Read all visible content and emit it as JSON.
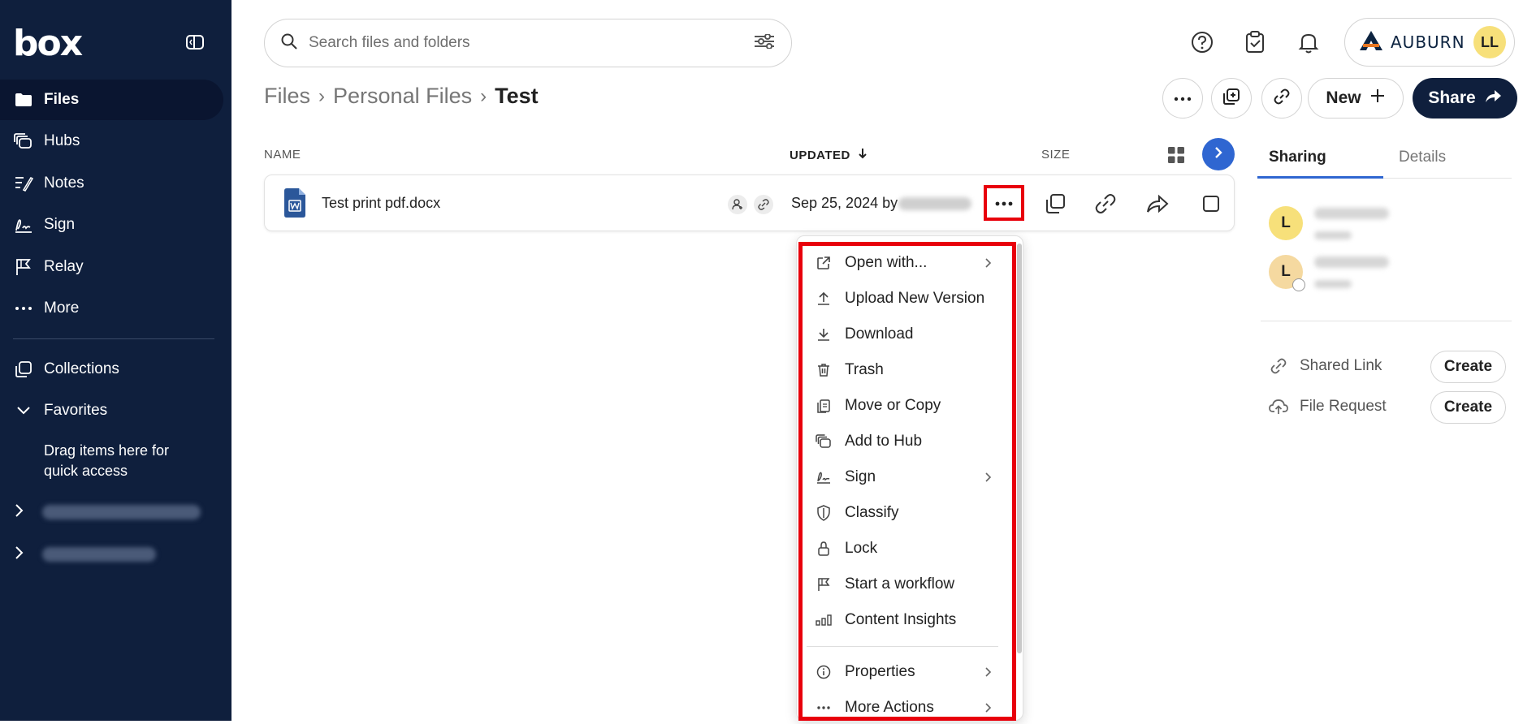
{
  "app": {
    "logo": "box"
  },
  "sidebar": {
    "items": [
      {
        "label": "Files",
        "icon": "folder-icon",
        "active": true
      },
      {
        "label": "Hubs",
        "icon": "hubs-icon"
      },
      {
        "label": "Notes",
        "icon": "notes-icon"
      },
      {
        "label": "Sign",
        "icon": "sign-icon"
      },
      {
        "label": "Relay",
        "icon": "relay-flag-icon"
      },
      {
        "label": "More",
        "icon": "more-dots-icon"
      },
      {
        "label": "Collections",
        "icon": "collections-icon"
      },
      {
        "label": "Favorites",
        "icon": "chevron-down-icon"
      }
    ],
    "favorites_hint": "Drag items here for quick access"
  },
  "search": {
    "placeholder": "Search files and folders"
  },
  "account": {
    "org": "AUBURN",
    "initials": "LL"
  },
  "breadcrumb": {
    "root": "Files",
    "parent": "Personal Files",
    "current": "Test"
  },
  "toolbar": {
    "new_label": "New",
    "share_label": "Share"
  },
  "table": {
    "columns": {
      "name": "NAME",
      "updated": "UPDATED",
      "size": "SIZE"
    },
    "rows": [
      {
        "name": "Test print pdf.docx",
        "updated": "Sep 25, 2024 by"
      }
    ]
  },
  "context_menu": {
    "items": [
      {
        "label": "Open with...",
        "icon": "open-external-icon",
        "submenu": true
      },
      {
        "label": "Upload New Version",
        "icon": "upload-icon"
      },
      {
        "label": "Download",
        "icon": "download-icon"
      },
      {
        "label": "Trash",
        "icon": "trash-icon"
      },
      {
        "label": "Move or Copy",
        "icon": "move-copy-icon"
      },
      {
        "label": "Add to Hub",
        "icon": "hubs-icon"
      },
      {
        "label": "Sign",
        "icon": "sign-icon",
        "submenu": true
      },
      {
        "label": "Classify",
        "icon": "shield-icon"
      },
      {
        "label": "Lock",
        "icon": "lock-icon"
      },
      {
        "label": "Start a workflow",
        "icon": "workflow-flag-icon"
      },
      {
        "label": "Content Insights",
        "icon": "insights-chart-icon"
      },
      {
        "label": "Properties",
        "icon": "info-icon",
        "submenu": true
      },
      {
        "label": "More Actions",
        "icon": "more-dots-icon",
        "submenu": true
      }
    ]
  },
  "panel": {
    "tabs": [
      {
        "label": "Sharing"
      },
      {
        "label": "Details"
      }
    ],
    "collaborators": [
      {
        "initial": "L"
      },
      {
        "initial": "L"
      }
    ],
    "shared_link": {
      "label": "Shared Link",
      "button": "Create"
    },
    "file_request": {
      "label": "File Request",
      "button": "Create"
    }
  },
  "colors": {
    "sidebar": "#0f1f3d",
    "accent": "#2f66d1",
    "highlight": "#e8000b",
    "avatar": "#f7e07a"
  }
}
